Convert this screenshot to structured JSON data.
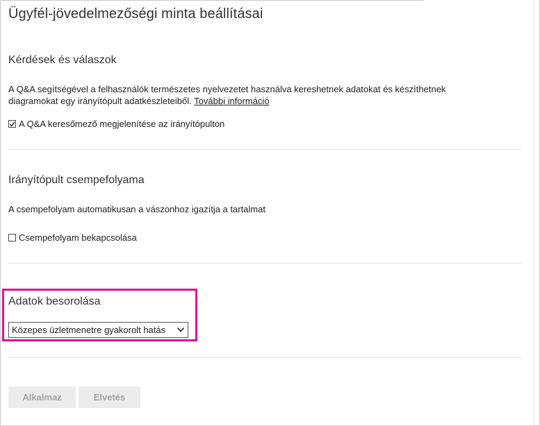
{
  "page": {
    "title": "Ügyfél-jövedelmezőségi minta beállításai"
  },
  "qa": {
    "heading": "Kérdések és válaszok",
    "description_line1": "A Q&A segítségével a felhasználók természetes nyelvezetet használva kereshetnek adatokat és készíthetnek",
    "description_line2": "diagramokat egy irányítópult adatkészleteiből.",
    "more_info_link": "További információ",
    "checkbox_label": "A Q&A keresőmező megjelenítése az irányítópulton",
    "checkbox_checked": true
  },
  "tile_flow": {
    "heading": "Irányítópult csempefolyama",
    "description": "A csempefolyam automatikusan a vászonhoz igazítja a tartalmat",
    "checkbox_label": "Csempefolyam bekapcsolása",
    "checkbox_checked": false
  },
  "classification": {
    "heading": "Adatok besorolása",
    "selected_value": "Közepes üzletmenetre gyakorolt hatás",
    "highlight_color": "#e5118d"
  },
  "actions": {
    "apply_label": "Alkalmaz",
    "discard_label": "Elvetés"
  }
}
